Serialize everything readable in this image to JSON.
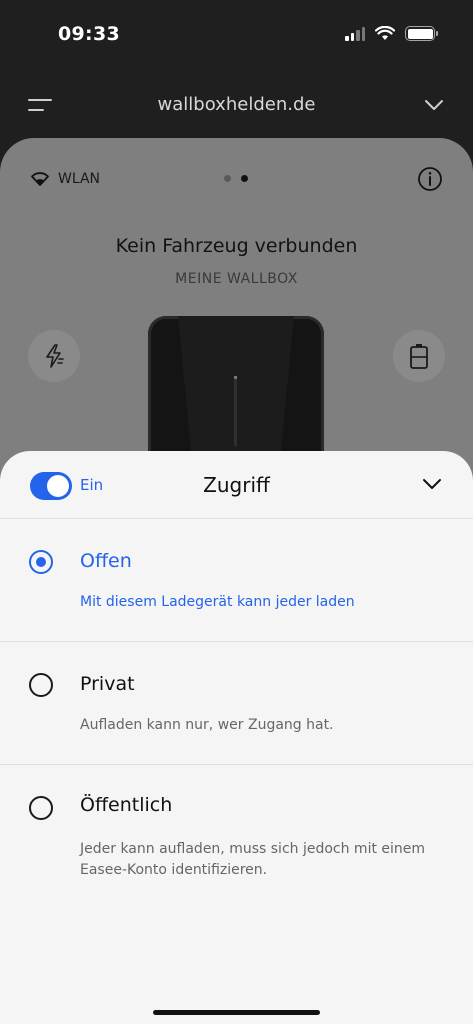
{
  "status": {
    "time": "09:33"
  },
  "nav": {
    "title": "wallboxhelden.de"
  },
  "card": {
    "wlan_label": "WLAN",
    "title": "Kein Fahrzeug verbunden",
    "subtitle": "MEINE WALLBOX"
  },
  "sheet": {
    "toggle_label": "Ein",
    "toggle_state": "on",
    "title": "Zugriff",
    "options": [
      {
        "title": "Offen",
        "description": "Mit diesem Ladegerät kann jeder laden",
        "selected": true
      },
      {
        "title": "Privat",
        "description": "Aufladen kann nur, wer Zugang hat.",
        "selected": false
      },
      {
        "title": "Öffentlich",
        "description": "Jeder kann aufladen, muss sich jedoch mit einem Easee-Konto identifizieren.",
        "selected": false
      }
    ]
  },
  "colors": {
    "accent": "#2463eb",
    "card": "#7f7f7f",
    "background": "#1f1f1f",
    "sheet": "#f5f5f5"
  },
  "icons": [
    "menu-icon",
    "chevron-down-icon",
    "wifi-icon",
    "info-icon",
    "lightning-icon",
    "battery-icon"
  ]
}
